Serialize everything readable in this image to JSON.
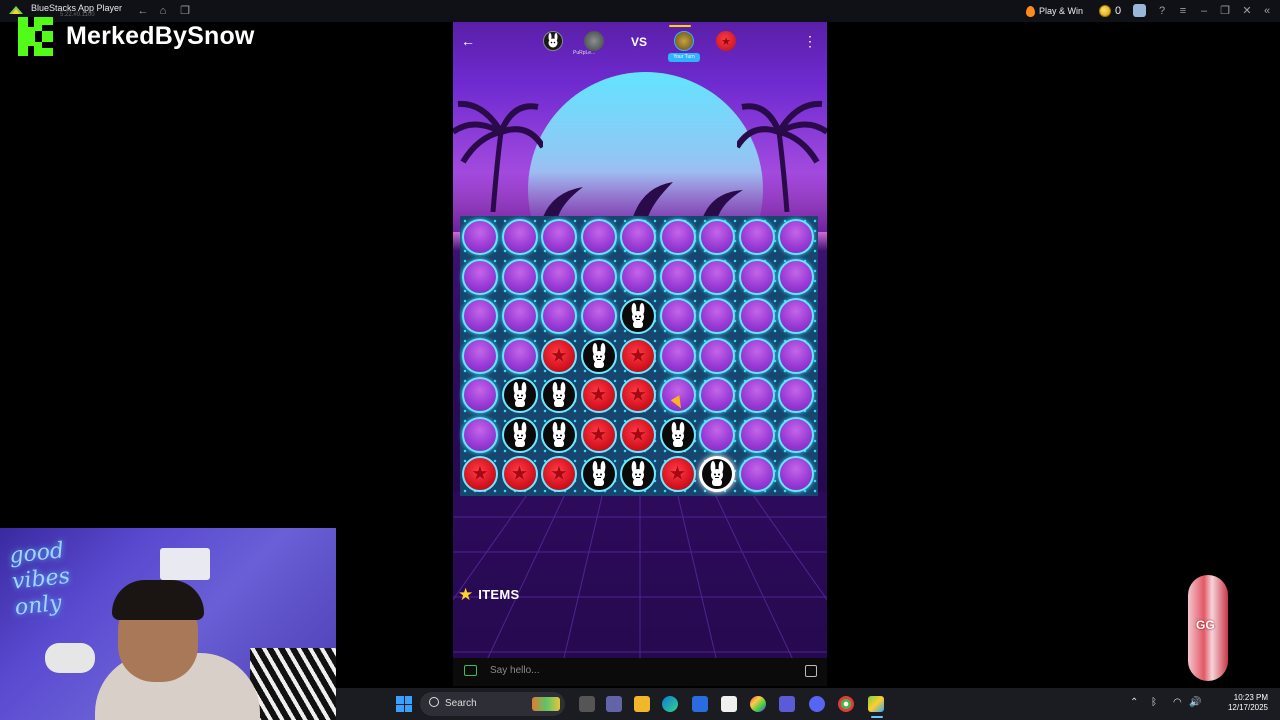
{
  "window": {
    "app_title": "BlueStacks App Player",
    "version": "5.22.#0.1100",
    "play_win_label": "Play & Win",
    "coin_count": "0"
  },
  "overlay": {
    "streamer_name": "MerkedBySnow"
  },
  "game": {
    "vs_label": "VS",
    "opponent_name": "PuRpLe...",
    "turn_label": "Your Turn",
    "items_label": "ITEMS",
    "board": {
      "cols": 9,
      "rows": 7,
      "grid": [
        ".........",
        ".........",
        "....B....",
        "..RBR....",
        ".BBRR....",
        ".BBRRB...",
        "RRRBBRB.."
      ],
      "last_move": {
        "row": 6,
        "col": 6
      }
    }
  },
  "chat": {
    "placeholder": "Say hello..."
  },
  "webcam": {
    "sign_text": "good vibes only"
  },
  "side_widget": {
    "label": "GG"
  },
  "taskbar": {
    "search_label": "Search",
    "time": "10:23 PM",
    "date": "12/17/2025"
  },
  "colors": {
    "player_red": "#d5121f",
    "player_bunny": "#0a0a0a",
    "board_ring": "#66e6ff",
    "kick_green": "#53fc18"
  }
}
